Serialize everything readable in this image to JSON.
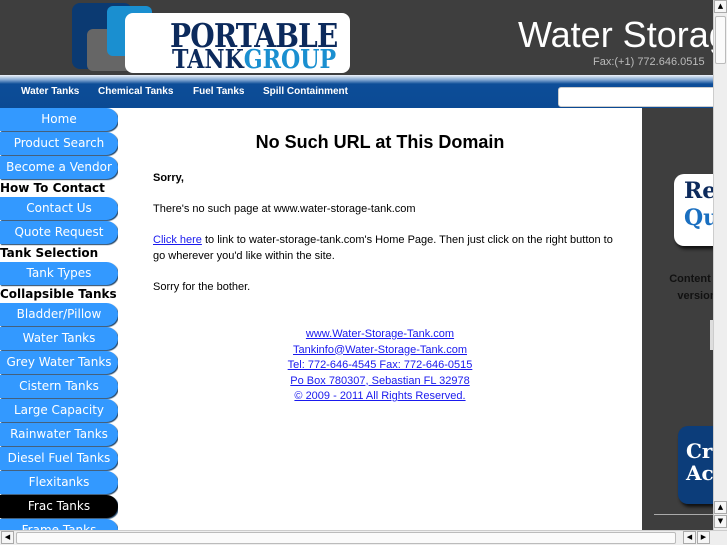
{
  "header": {
    "logo_text_1": "PORTABLE",
    "logo_text_2a": "TANK",
    "logo_text_2b": "GROUP",
    "site_title": "Water Storage",
    "fax": "Fax:(+1) 772.646.0515"
  },
  "nav": {
    "items": [
      "Water Tanks",
      "Chemical Tanks",
      "Fuel Tanks",
      "Spill Containment"
    ],
    "search_value": ""
  },
  "sidebar": {
    "home": "Home",
    "product_search": "Product Search",
    "become_vendor": "Become a Vendor",
    "h_contact": "How To Contact",
    "contact_us": "Contact Us",
    "quote_request": "Quote Request",
    "h_selection": "Tank Selection",
    "tank_types": "Tank Types",
    "h_collapsible": "Collapsible Tanks",
    "items": [
      "Bladder/Pillow",
      "Water Tanks",
      "Grey Water Tanks",
      "Cistern Tanks",
      "Large Capacity",
      "Rainwater Tanks",
      "Diesel Fuel Tanks",
      "Flexitanks",
      "Frac Tanks",
      "Frame Tanks"
    ],
    "active": "Frac Tanks"
  },
  "main": {
    "title": "No Such URL at This Domain",
    "sorry": "Sorry,",
    "no_page": "There's no such page at www.water-storage-tank.com",
    "click_here": "Click here",
    "click_rest": " to link to water-storage-tank.com's Home Page. Then just click on the right button to go wherever you'd like within the site.",
    "bother": "Sorry for the bother.",
    "footer": [
      "www.Water-Storage-Tank.com",
      "Tankinfo@Water-Storage-Tank.com",
      "Tel: 772-646-4545 Fax: 772-646-0515",
      "Po Box 780307, Sebastian FL 32978",
      "© 2009 - 2011 All Rights Reserved."
    ]
  },
  "right": {
    "quote_banner_1": "Re",
    "quote_banner_2": "Qu",
    "text_1": "Content or",
    "text_2": "version",
    "credit_banner_1": "Cre",
    "credit_banner_2": "Ac"
  },
  "colors": {
    "header_bg": "#3e3e3e",
    "nav_bg": "#0b4a94",
    "sidebar_button": "#3399ff",
    "sidebar_active": "#000000",
    "link": "#1a1aee"
  }
}
